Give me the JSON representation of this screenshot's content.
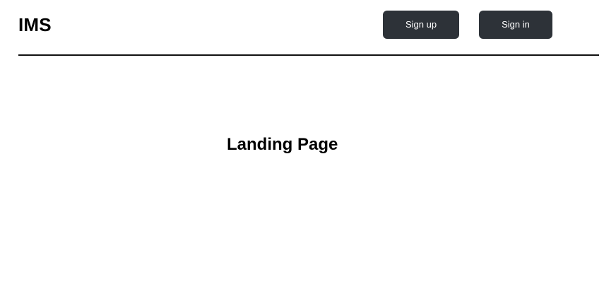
{
  "header": {
    "brand": "IMS",
    "signup_label": "Sign up",
    "signin_label": "Sign in"
  },
  "main": {
    "title": "Landing Page"
  },
  "colors": {
    "button_bg": "#2d3238",
    "button_text": "#ffffff",
    "divider": "#111111",
    "background": "#ffffff"
  }
}
